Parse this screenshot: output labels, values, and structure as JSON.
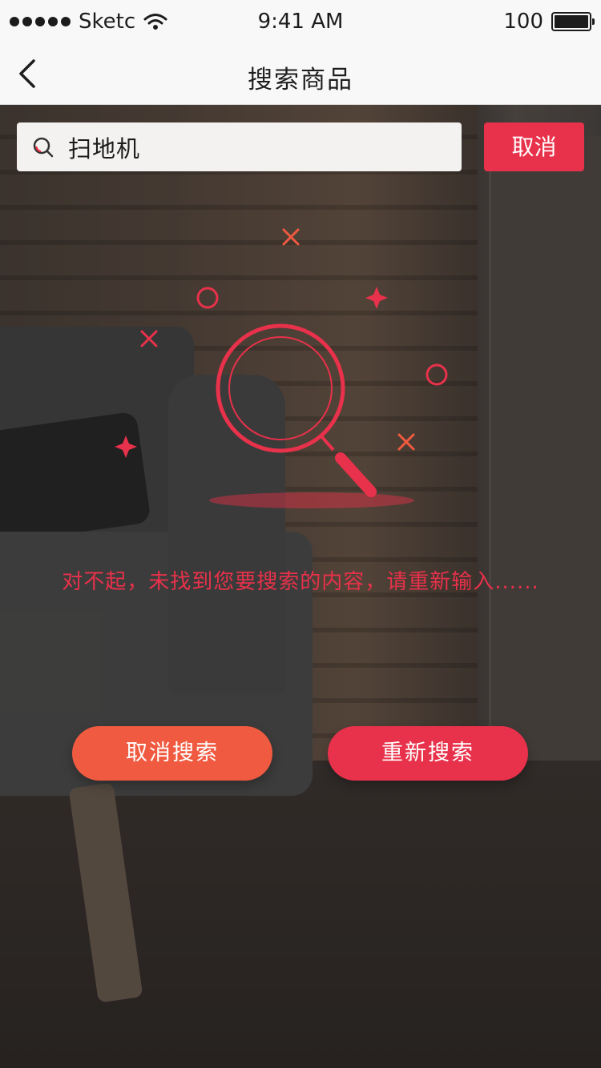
{
  "status_bar": {
    "carrier": "Sketc",
    "time": "9:41 AM",
    "battery": "100"
  },
  "nav": {
    "title": "搜索商品"
  },
  "search": {
    "query": "扫地机",
    "cancel_label": "取消"
  },
  "empty_state": {
    "message": "对不起，未找到您要搜索的内容，请重新输入......"
  },
  "actions": {
    "cancel_search_label": "取消搜索",
    "retry_search_label": "重新搜索"
  },
  "colors": {
    "accent_red": "#e8314a",
    "accent_orange": "#f05a40"
  },
  "icons": {
    "back": "chevron-left-icon",
    "search": "search-icon",
    "wifi": "wifi-icon",
    "battery": "battery-icon",
    "illustration": "magnifier-illustration"
  }
}
